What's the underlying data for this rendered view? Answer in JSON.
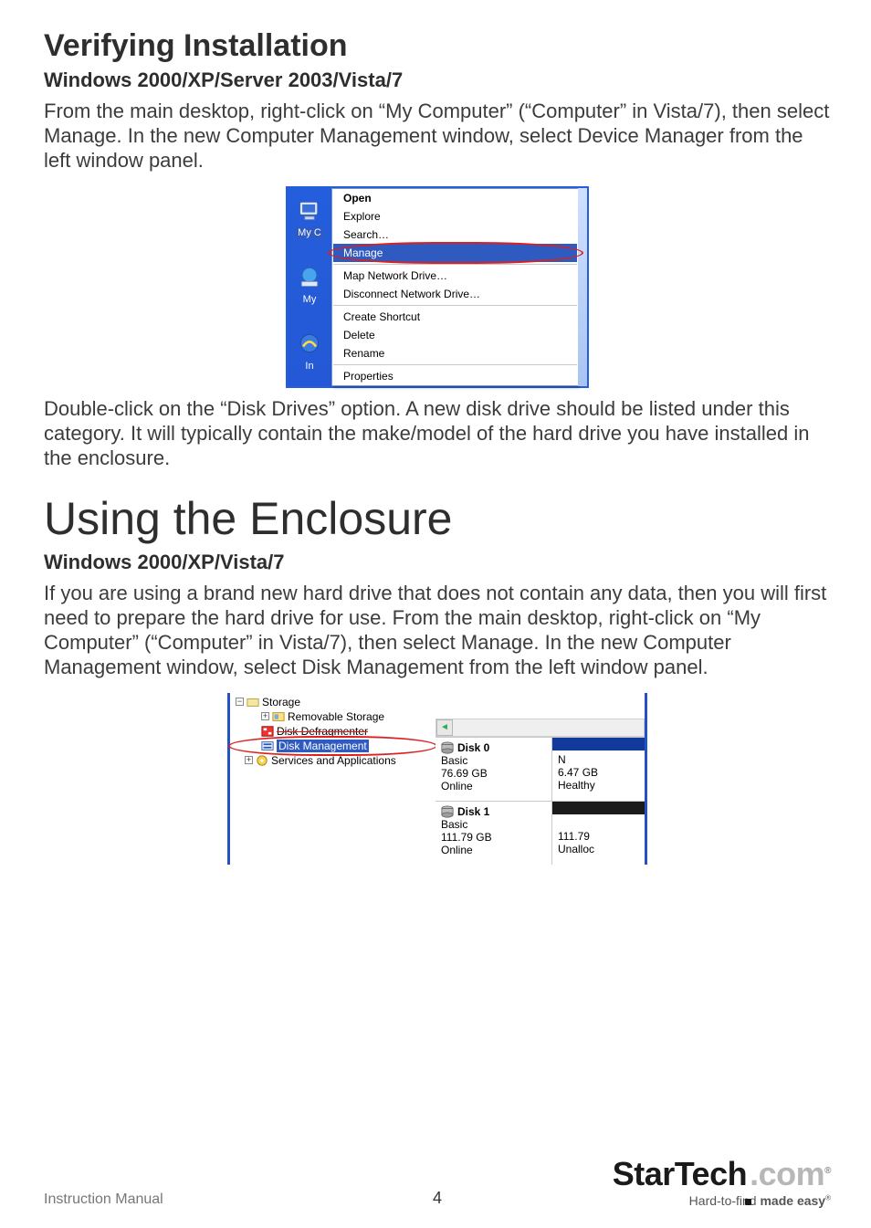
{
  "section1": {
    "heading": "Verifying Installation",
    "sub": "Windows 2000/XP/Server 2003/Vista/7",
    "para1": "From the main desktop, right-click on “My Computer” (“Computer” in Vista/7), then select Manage. In the new Computer Management window, select Device Manager from the left window panel.",
    "para2": "Double-click on the “Disk Drives” option. A new disk drive should be listed under this category.  It will typically contain the make/model of the hard drive you have installed in the enclosure."
  },
  "shot1": {
    "left_labels": {
      "mycomputer": "My C",
      "mynetwork": "My",
      "bottom": "In"
    },
    "menu": {
      "open": "Open",
      "explore": "Explore",
      "search": "Search…",
      "manage": "Manage",
      "map": "Map Network Drive…",
      "disconnect": "Disconnect Network Drive…",
      "shortcut": "Create Shortcut",
      "delete": "Delete",
      "rename": "Rename",
      "properties": "Properties"
    }
  },
  "section2": {
    "heading": "Using the Enclosure",
    "sub": "Windows 2000/XP/Vista/7",
    "para": "If you are using a brand new hard drive that does not contain any data, then you will first need to prepare the hard drive for use.  From the main desktop, right-click on “My Computer” (“Computer” in Vista/7), then select Manage. In the new Computer Management window, select Disk Management from the left window panel."
  },
  "shot2": {
    "tree": {
      "storage": "Storage",
      "removable": "Removable Storage",
      "defrag": "Disk Defragmenter",
      "dm": "Disk Management",
      "services": "Services and Applications"
    },
    "disks": [
      {
        "title": "Disk 0",
        "type": "Basic",
        "size": "76.69 GB",
        "status": "Online",
        "bar": "blue",
        "right": "N\n6.47 GB\nHealthy"
      },
      {
        "title": "Disk 1",
        "type": "Basic",
        "size": "111.79 GB",
        "status": "Online",
        "bar": "gray",
        "right": "\n111.79\nUnalloc"
      }
    ]
  },
  "footer": {
    "left": "Instruction Manual",
    "center": "4",
    "brand_main": "StarTech",
    "brand_com": ".com",
    "brand_tag_a": "Hard-to-find ",
    "brand_tag_b": "made easy"
  }
}
